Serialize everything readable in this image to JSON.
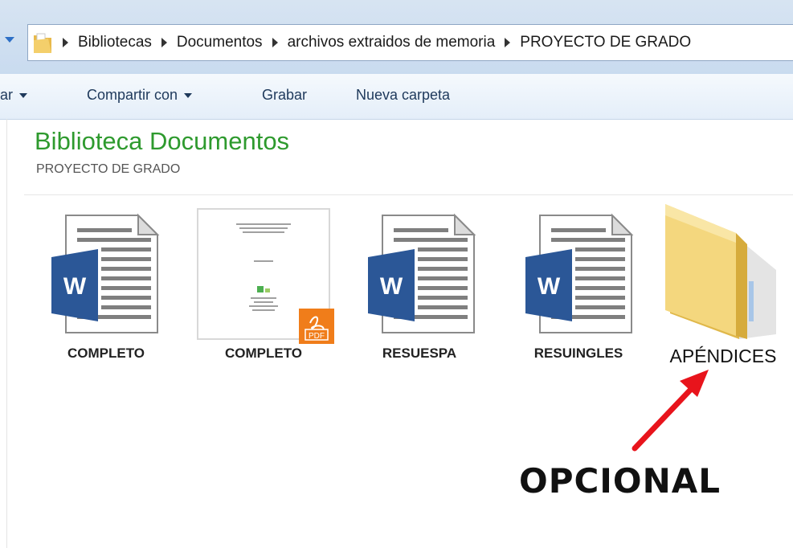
{
  "address_bar": {
    "crumbs": [
      "Bibliotecas",
      "Documentos",
      "archivos extraidos de memoria",
      "PROYECTO DE GRADO"
    ]
  },
  "toolbar": {
    "organize_partial": "ar",
    "share_label": "Compartir con",
    "burn_label": "Grabar",
    "new_folder_label": "Nueva carpeta"
  },
  "library": {
    "title": "Biblioteca Documentos",
    "subtitle": "PROYECTO DE GRADO"
  },
  "files": [
    {
      "name": "COMPLETO",
      "icon": "word-document-icon"
    },
    {
      "name": "COMPLETO",
      "icon": "pdf-document-icon"
    },
    {
      "name": "RESUESPA",
      "icon": "word-document-icon"
    },
    {
      "name": "RESUINGLES",
      "icon": "word-document-icon"
    },
    {
      "name": "APÉNDICES",
      "icon": "folder-icon"
    }
  ],
  "annotation": {
    "text": "OPCIONAL",
    "arrow_color": "#e8141c"
  },
  "colors": {
    "title_green": "#2e9a2e",
    "word_blue": "#2b5797",
    "pdf_orange": "#f07d1a",
    "folder_yellow": "#f2d37a"
  }
}
